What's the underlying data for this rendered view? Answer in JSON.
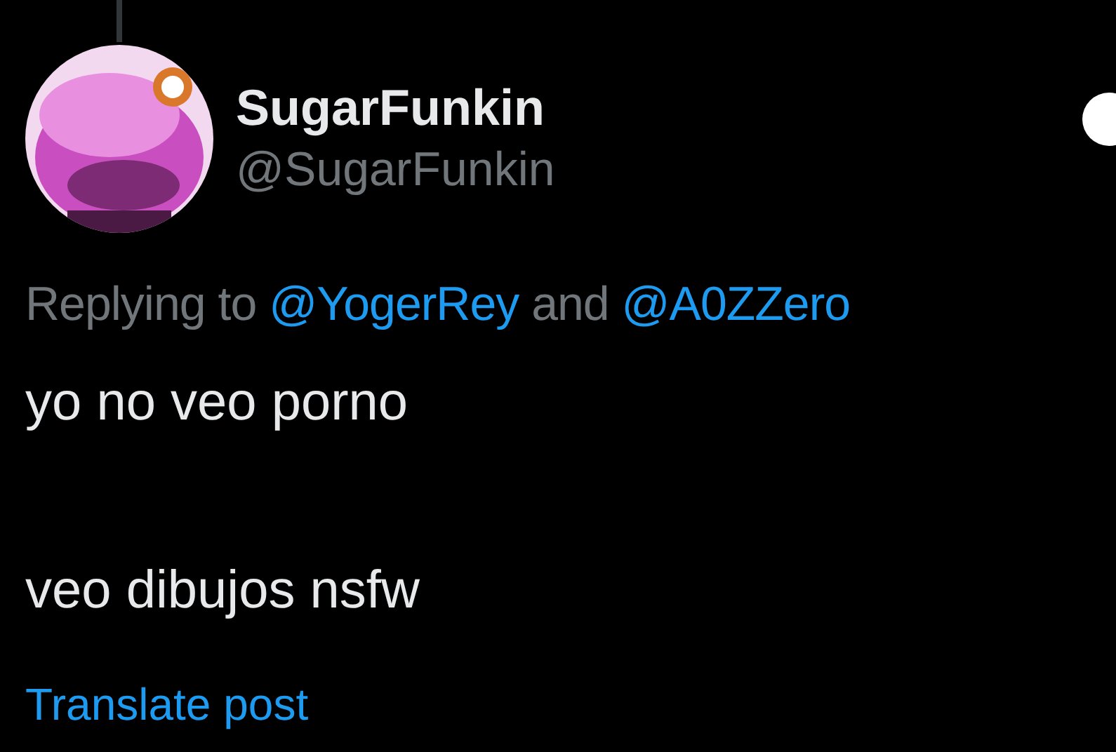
{
  "author": {
    "name": "SugarFunkin",
    "handle": "@SugarFunkin"
  },
  "reply": {
    "prefix": "Replying to",
    "mentions": [
      "@YogerRey",
      "@A0ZZero"
    ],
    "joiner": "and"
  },
  "body": [
    "yo no veo porno",
    "veo dibujos nsfw"
  ],
  "translate": "Translate post"
}
